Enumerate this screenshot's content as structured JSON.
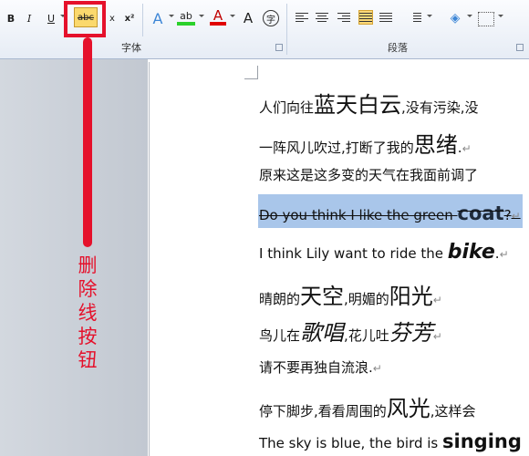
{
  "ribbon": {
    "font_group_label": "字体",
    "paragraph_group_label": "段落",
    "bold_label": "B",
    "italic_label": "I",
    "underline_label": "U",
    "strikethrough_label": "abc",
    "subscript_label": "x",
    "superscript_label": "x²",
    "text_effect_label": "A",
    "highlight_label": "ab",
    "font_color_label": "A",
    "phonetic_label": "A",
    "enclose_label": "字"
  },
  "callout": {
    "text": "删除线按钮"
  },
  "document": {
    "line1": {
      "a": "人们向往",
      "b": "蓝天白云",
      "c": ",没有污染,没"
    },
    "line2": {
      "a": "一阵风儿吹过,打断了我的",
      "b": "思绪",
      "c": "."
    },
    "line3": {
      "a": "原来这是这多变的天气在我面前调了"
    },
    "line4": {
      "a": "Do you think I like the green ",
      "b": "coat",
      "c": "?"
    },
    "line5": {
      "a": "I think Lily want to ride the ",
      "b": "bike",
      "c": "."
    },
    "line6": {
      "a": "晴朗的",
      "b": "天空",
      "c": ",明媚的",
      "d": "阳光"
    },
    "line7": {
      "a": "鸟儿在",
      "b": "歌唱",
      "c": ",花儿吐",
      "d": "芬芳"
    },
    "line8": {
      "a": "请不要再独自流浪."
    },
    "line9": {
      "a": "停下脚步,看看周围的",
      "b": "风光",
      "c": ",这样会"
    },
    "line10": {
      "a": "The sky is blue, the bird is ",
      "b": "singing"
    }
  },
  "colors": {
    "accent_red": "#e5112b",
    "selection": "#a9c6ea",
    "active_button": "#fbd96d"
  }
}
